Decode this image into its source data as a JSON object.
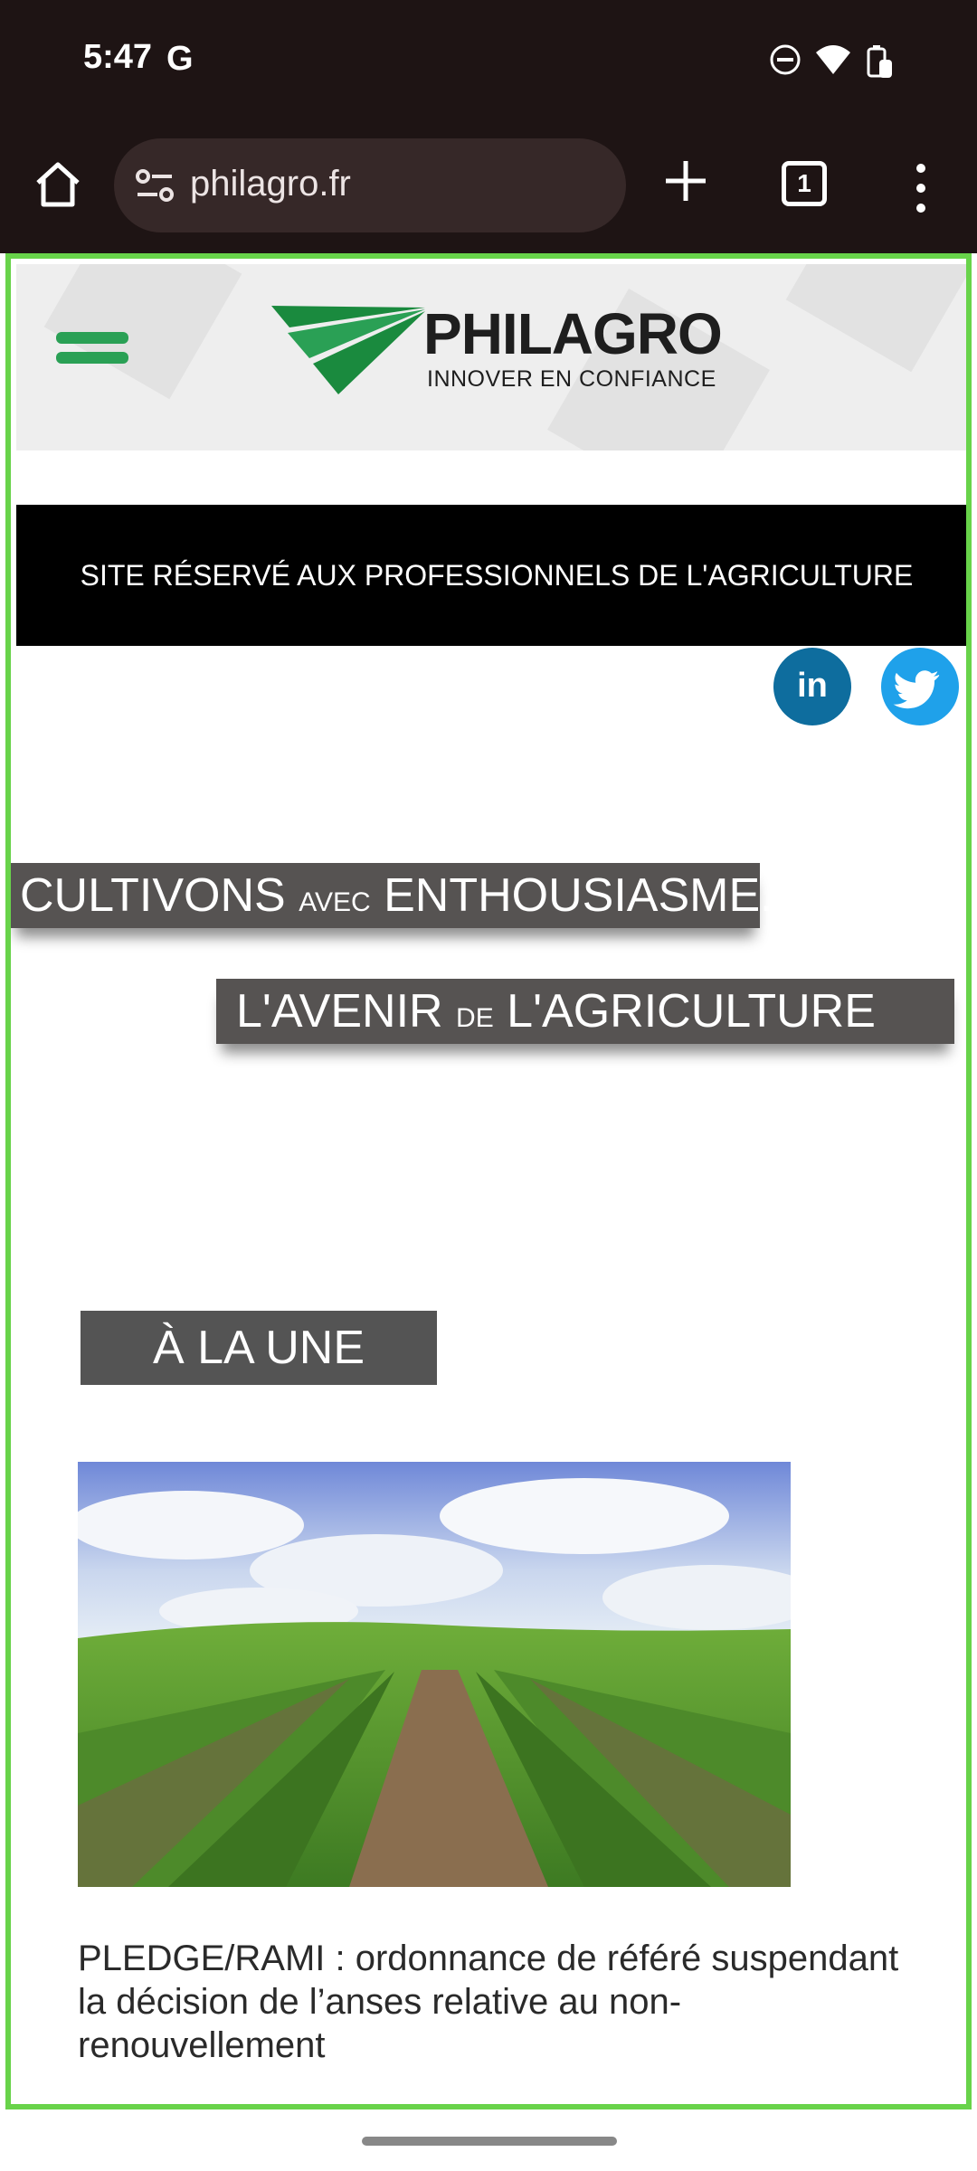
{
  "status_bar": {
    "time": "5:47",
    "g_label": "G"
  },
  "toolbar": {
    "url": "philagro.fr",
    "tab_count": "1"
  },
  "site": {
    "logo_name": "PHILAGRO",
    "logo_tagline": "INNOVER EN CONFIANCE",
    "banner_text": "SITE RÉSERVÉ AUX PROFESSIONNELS DE L'AGRICULTURE",
    "linkedin_label": "in",
    "slogan1": {
      "part1": "CULTIVONS ",
      "small": "AVEC",
      "part2": " ENTHOUSIASME..."
    },
    "slogan2": {
      "part1": "L'AVENIR ",
      "small": "DE",
      "part2": " L'AGRICULTURE"
    },
    "featured_label": "À LA UNE",
    "news_title": "PLEDGE/RAMI : ordonnance de référé suspendant la décision de l’anses relative au non-renouvellement"
  },
  "colors": {
    "brand_green": "#2aa055",
    "frame_green": "#68d34a",
    "linkedin": "#0e6d9e",
    "twitter": "#1fa1ea"
  }
}
